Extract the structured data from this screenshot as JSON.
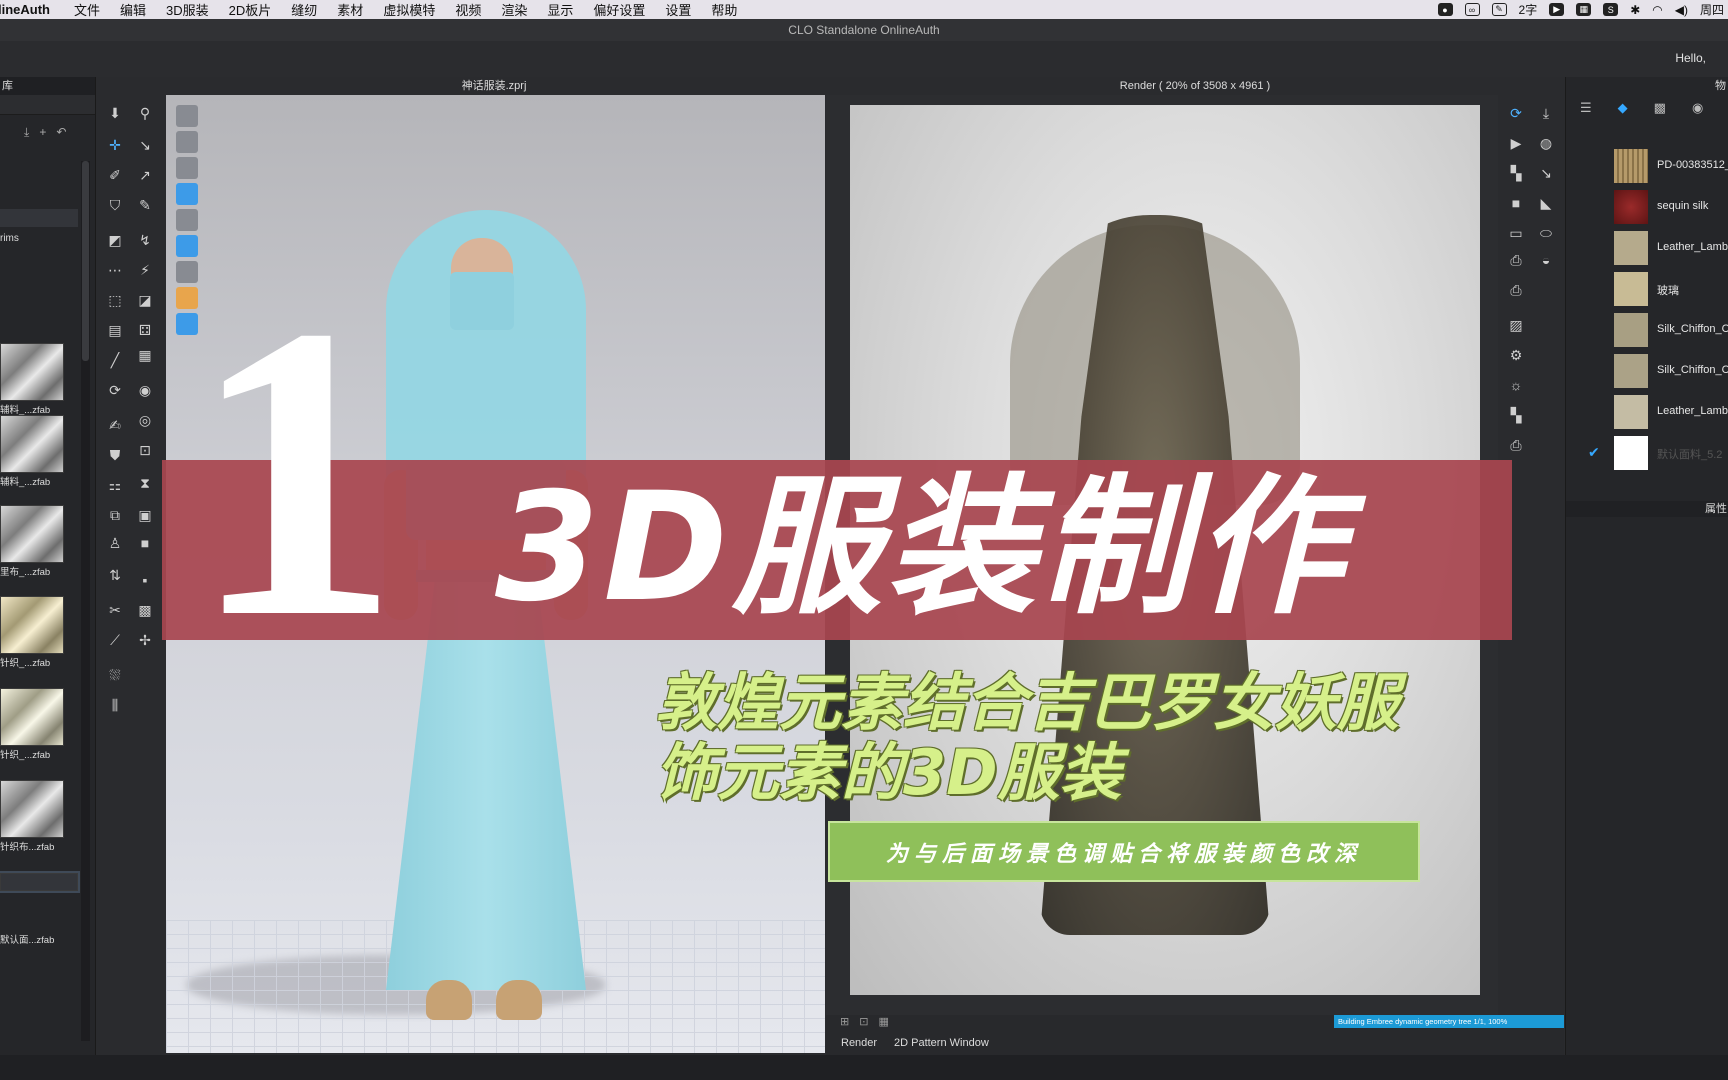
{
  "menubar": {
    "app": "lineAuth",
    "items": [
      "文件",
      "编辑",
      "3D服装",
      "2D板片",
      "缝纫",
      "素材",
      "虚拟模特",
      "视频",
      "渲染",
      "显示",
      "偏好设置",
      "设置",
      "帮助"
    ],
    "ime": "2字",
    "day": "周四"
  },
  "window": {
    "title": "CLO Standalone OnlineAuth",
    "greeting": "Hello,"
  },
  "library": {
    "header": "库",
    "folder": "rims",
    "items": [
      {
        "label": "辅料_...zfab",
        "swatch": "gray"
      },
      {
        "label": "辅料_...zfab",
        "swatch": "gray"
      },
      {
        "label": "里布_...zfab",
        "swatch": "gray"
      },
      {
        "label": "针织_...zfab",
        "swatch": "yellow"
      },
      {
        "label": "针织_...zfab",
        "swatch": "lightyellow"
      },
      {
        "label": "针织布...zfab",
        "swatch": "gray"
      },
      {
        "label": "默认面...zfab",
        "swatch": "gray"
      }
    ]
  },
  "viewport3d": {
    "title": "神话服装.zprj"
  },
  "render": {
    "title": "Render ( 20% of 3508 x 4961 )",
    "tabs": [
      "Render",
      "2D Pattern Window"
    ],
    "progress_text": "Building Embree dynamic geometry tree 1/1, 100%",
    "progress_color": "#1c9ad6"
  },
  "object_browser": {
    "header": "物",
    "property_header": "属性",
    "fabrics": [
      {
        "name": "PD-00383512_",
        "color": "#b59a6a",
        "checked": false,
        "dim": false
      },
      {
        "name": "sequin silk",
        "color": "#7a1f1f",
        "checked": false,
        "dim": false
      },
      {
        "name": "Leather_Lambs",
        "color": "#b5aa8c",
        "checked": false,
        "dim": false
      },
      {
        "name": "玻璃",
        "color": "#c8bb95",
        "checked": false,
        "dim": false
      },
      {
        "name": "Silk_Chiffon_Co",
        "color": "#a89f83",
        "checked": false,
        "dim": false
      },
      {
        "name": "Silk_Chiffon_Co",
        "color": "#aba287",
        "checked": false,
        "dim": false
      },
      {
        "name": "Leather_Lambs",
        "color": "#c4bca4",
        "checked": false,
        "dim": false
      },
      {
        "name": "默认面料_5.2",
        "color": "#ffffff",
        "checked": true,
        "dim": true
      }
    ]
  },
  "overlay": {
    "number": "1",
    "title": "3D服装制作",
    "subtitle_line1": "敦煌元素结合吉巴罗女妖服",
    "subtitle_line2": "饰元素的3D服装",
    "note": "为与后面场景色调贴合将服装颜色改深",
    "banner_color": "#a84650",
    "subtitle_color": "#d6f08a",
    "note_bg": "#8fc05a"
  }
}
